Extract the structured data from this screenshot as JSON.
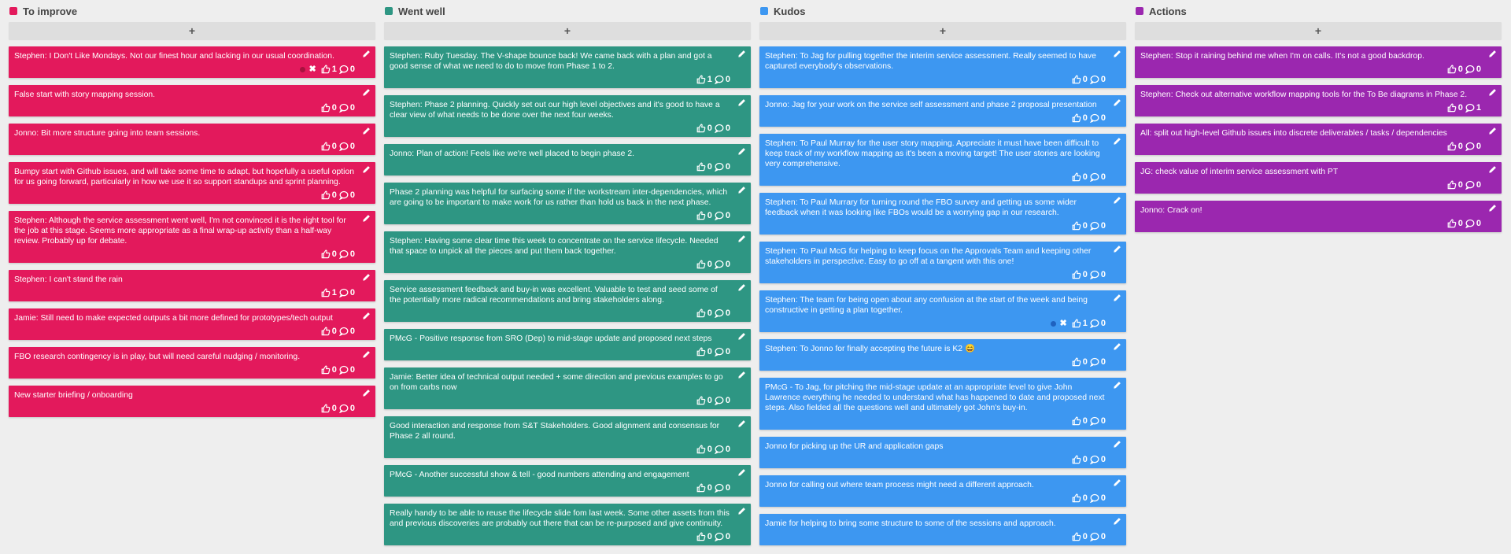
{
  "columns": [
    {
      "id": "improve",
      "title": "To improve",
      "color": "#e3195c",
      "add_label": "+",
      "cards": [
        {
          "text": "Stephen: I Don't Like Mondays. Not our finest hour and lacking in our usual coordination.",
          "likes": "1",
          "comments": "0",
          "voted": true,
          "vote_dot_color": "#a8123f"
        },
        {
          "text": "False start with story mapping session.",
          "likes": "0",
          "comments": "0"
        },
        {
          "text": "Jonno: Bit more structure going into team sessions.",
          "likes": "0",
          "comments": "0"
        },
        {
          "text": "Bumpy start with Github issues, and will take some time to adapt, but hopefully a useful option for us going forward, particularly in how we use it so support standups and sprint planning.",
          "likes": "0",
          "comments": "0"
        },
        {
          "text": "Stephen: Although the service assessment went well, I'm not convinced it is the right tool for the job at this stage. Seems more appropriate as a final wrap-up activity than a half-way review. Probably up for debate.",
          "likes": "0",
          "comments": "0"
        },
        {
          "text": "Stephen: I can't stand the rain",
          "likes": "1",
          "comments": "0"
        },
        {
          "text": "Jamie: Still need to make expected outputs a bit more defined for prototypes/tech output",
          "likes": "0",
          "comments": "0"
        },
        {
          "text": "FBO research contingency is in play, but will need careful nudging / monitoring.",
          "likes": "0",
          "comments": "0"
        },
        {
          "text": "New starter briefing / onboarding",
          "likes": "0",
          "comments": "0"
        }
      ]
    },
    {
      "id": "went-well",
      "title": "Went well",
      "color": "#2e9683",
      "add_label": "+",
      "cards": [
        {
          "text": "Stephen: Ruby Tuesday. The V-shape bounce back! We came back with a plan and got a good sense of what we need to do to move from Phase 1 to 2.",
          "likes": "1",
          "comments": "0"
        },
        {
          "text": "Stephen: Phase 2 planning. Quickly set out our high level objectives and it's good to have a clear view of what needs to be done over the next four weeks.",
          "likes": "0",
          "comments": "0"
        },
        {
          "text": "Jonno: Plan of action! Feels like we're well placed to begin phase 2.",
          "likes": "0",
          "comments": "0"
        },
        {
          "text": "Phase 2 planning was helpful for surfacing some if the workstream inter-dependencies, which are going to be important to make work for us rather than hold us back in the next phase.",
          "likes": "0",
          "comments": "0"
        },
        {
          "text": "Stephen: Having some clear time this week to concentrate on the service lifecycle. Needed that space to unpick all the pieces and put them back together.",
          "likes": "0",
          "comments": "0"
        },
        {
          "text": "Service assessment feedback and buy-in was excellent. Valuable to test and seed some of the potentially more radical recommendations and bring stakeholders along.",
          "likes": "0",
          "comments": "0"
        },
        {
          "text": "PMcG - Positive response from SRO (Dep) to mid-stage update and proposed next steps",
          "likes": "0",
          "comments": "0"
        },
        {
          "text": "Jamie: Better idea of technical output needed + some direction and previous examples to go on from carbs now",
          "likes": "0",
          "comments": "0"
        },
        {
          "text": "Good interaction and response from S&T Stakeholders. Good alignment and consensus for Phase 2 all round.",
          "likes": "0",
          "comments": "0"
        },
        {
          "text": "PMcG - Another successful show & tell - good numbers attending and engagement",
          "likes": "0",
          "comments": "0"
        },
        {
          "text": "Really handy to be able to reuse the lifecycle slide fom last week. Some other assets from this and previous discoveries are probably out there that can be re-purposed and give continuity.",
          "likes": "0",
          "comments": "0"
        }
      ]
    },
    {
      "id": "kudos",
      "title": "Kudos",
      "color": "#3d97f1",
      "add_label": "+",
      "cards": [
        {
          "text": "Stephen: To Jag for pulling together the interim service assessment. Really seemed to have captured everybody's observations.",
          "likes": "0",
          "comments": "0"
        },
        {
          "text": "Jonno: Jag for your work on the service self assessment and phase 2 proposal presentation",
          "likes": "0",
          "comments": "0"
        },
        {
          "text": "Stephen: To Paul Murray for the user story mapping. Appreciate it must have been difficult to keep track of my workflow mapping as it's been a moving target! The user stories are looking very comprehensive.",
          "likes": "0",
          "comments": "0"
        },
        {
          "text": "Stephen: To Paul Murrary for turning round the FBO survey and getting us some wider feedback when it was looking like FBOs would be a worrying gap in our research.",
          "likes": "0",
          "comments": "0"
        },
        {
          "text": "Stephen: To Paul McG for helping to keep focus on the Approvals Team and keeping other stakeholders in perspective. Easy to go off at a tangent with this one!",
          "likes": "0",
          "comments": "0"
        },
        {
          "text": "Stephen: The team for being open about any confusion at the start of the week and being constructive in getting a plan together.",
          "likes": "1",
          "comments": "0",
          "voted": true,
          "vote_dot_color": "#1f62c0"
        },
        {
          "text": "Stephen: To Jonno for finally accepting the future is K2 😄",
          "likes": "0",
          "comments": "0"
        },
        {
          "text": "PMcG - To Jag, for pitching the mid-stage update at an appropriate level to give John Lawrence everything he needed to understand what has happened to date and proposed next steps. Also fielded all the questions well and ultimately got John's buy-in.",
          "likes": "0",
          "comments": "0"
        },
        {
          "text": "Jonno for picking up the UR and application gaps",
          "likes": "0",
          "comments": "0"
        },
        {
          "text": "Jonno for calling out where team process might need a different approach.",
          "likes": "0",
          "comments": "0"
        },
        {
          "text": "Jamie for helping to bring some structure to some of the sessions and approach.",
          "likes": "0",
          "comments": "0"
        }
      ]
    },
    {
      "id": "actions",
      "title": "Actions",
      "color": "#9b27af",
      "add_label": "+",
      "cards": [
        {
          "text": "Stephen: Stop it raining behind me when I'm on calls. It's not a good backdrop.",
          "likes": "0",
          "comments": "0"
        },
        {
          "text": "Stephen: Check out alternative workflow mapping tools for the To Be diagrams in Phase 2.",
          "likes": "0",
          "comments": "1"
        },
        {
          "text": "All: split out high-level Github issues into discrete deliverables / tasks / dependencies",
          "likes": "0",
          "comments": "0"
        },
        {
          "text": "JG: check value of interim service assessment with PT",
          "likes": "0",
          "comments": "0"
        },
        {
          "text": "Jonno: Crack on!",
          "likes": "0",
          "comments": "0"
        }
      ]
    }
  ],
  "icons": {
    "edit": "pencil-icon",
    "like": "thumbs-up-icon",
    "comment": "comment-bubble-icon",
    "remove_vote": "x-icon"
  },
  "remove_vote_glyph": "✖"
}
